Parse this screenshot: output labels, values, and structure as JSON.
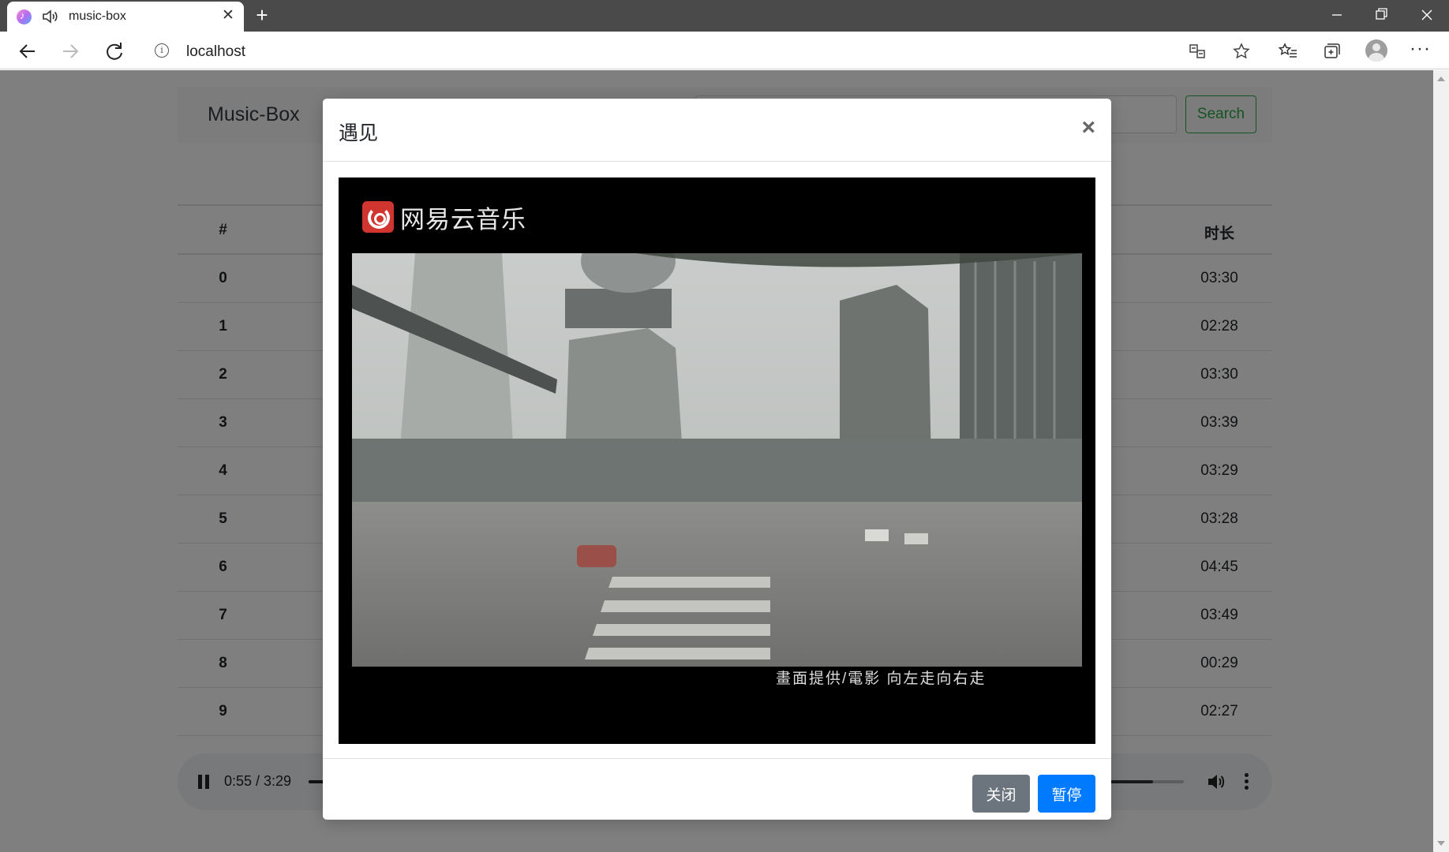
{
  "browser": {
    "tab_title": "music-box",
    "url": "localhost",
    "new_tab_symbol": "+",
    "tab_close_symbol": "✕",
    "more_symbol": "···"
  },
  "navbar": {
    "brand": "Music-Box",
    "search_button": "Search"
  },
  "table": {
    "header": {
      "index": "#",
      "duration": "时长"
    },
    "rows": [
      {
        "index": "0",
        "duration": "03:30"
      },
      {
        "index": "1",
        "duration": "02:28"
      },
      {
        "index": "2",
        "duration": "03:30"
      },
      {
        "index": "3",
        "duration": "03:39"
      },
      {
        "index": "4",
        "duration": "03:29"
      },
      {
        "index": "5",
        "duration": "03:28"
      },
      {
        "index": "6",
        "duration": "04:45"
      },
      {
        "index": "7",
        "duration": "03:49"
      },
      {
        "index": "8",
        "duration": "00:29"
      },
      {
        "index": "9",
        "duration": "02:27"
      }
    ]
  },
  "player": {
    "time": "0:55 / 3:29",
    "state": "playing",
    "volume_fraction": 0.62
  },
  "modal": {
    "title": "遇见",
    "close_symbol": "×",
    "video": {
      "logo_text": "网易云音乐",
      "caption": "畫面提供/電影 向左走向右走"
    },
    "buttons": {
      "close": "关闭",
      "pause": "暂停"
    }
  }
}
